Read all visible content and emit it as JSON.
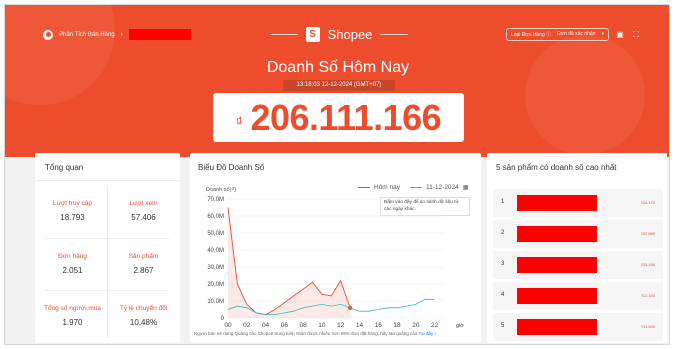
{
  "header": {
    "shop_label": "Phân Tích Bán Hàng",
    "brand": "Shopee",
    "order_type_label": "Loại Đơn Hàng ⓘ",
    "order_type_value": "Đơn đã xác nhận",
    "title": "Doanh Số Hôm Nay",
    "timestamp": "13:18:03 12-12-2024 (GMT+07)",
    "currency": "₫",
    "sales_value": "206.111.166",
    "redact_color": "#ff0000",
    "accent_color": "#ee4d2d"
  },
  "overview": {
    "title": "Tổng quan",
    "metrics": [
      {
        "label": "Lượt truy cập",
        "value": "18.793"
      },
      {
        "label": "Lượt xem",
        "value": "57.406"
      },
      {
        "label": "Đơn hàng",
        "value": "2.051"
      },
      {
        "label": "Sản phẩm",
        "value": "2.867"
      },
      {
        "label": "Tổng số người mua",
        "value": "1.970"
      },
      {
        "label": "Tỷ lệ chuyển đổi",
        "value": "10,48%"
      }
    ]
  },
  "chart_panel": {
    "title": "Biểu Đồ Doanh Số",
    "legend_today": "Hôm nay",
    "legend_compare": "11-12-2024",
    "tooltip": "Bấm vào đây để so sánh dữ liệu từ các ngày khác.",
    "note_prefix": "Người bán sử dụng Quảng cáo Shopee trung bình nhận được nhiều hơn 65% đơn đặt hàng, hãy tạo quảng cáo",
    "note_link": "Tại đây !"
  },
  "chart_data": {
    "type": "line",
    "ylabel": "Doanh số(₫)",
    "xlabel": "giờ",
    "y_ticks": [
      "0",
      "10,0M",
      "20,0M",
      "30,0M",
      "40,0M",
      "50,0M",
      "60,0M",
      "70,0M"
    ],
    "x_ticks": [
      "00",
      "02",
      "04",
      "06",
      "08",
      "10",
      "12",
      "14",
      "16",
      "18",
      "20",
      "22"
    ],
    "ylim": [
      0,
      70
    ],
    "xlim": [
      0,
      23
    ],
    "series": [
      {
        "name": "Hôm nay",
        "color": "#ee4d2d",
        "x": [
          0,
          1,
          2,
          3,
          4,
          5,
          6,
          7,
          8,
          9,
          10,
          11,
          12,
          13
        ],
        "y": [
          65,
          20,
          8,
          3,
          2,
          5,
          9,
          13,
          17,
          21,
          14,
          13,
          22,
          6
        ]
      },
      {
        "name": "11-12-2024",
        "color": "#2bc0b5",
        "x": [
          0,
          1,
          2,
          3,
          4,
          5,
          6,
          7,
          8,
          9,
          10,
          11,
          12,
          13,
          14,
          15,
          16,
          17,
          18,
          19,
          20,
          21,
          22
        ],
        "y": [
          5,
          7,
          6,
          3,
          2,
          2,
          3,
          4,
          6,
          7,
          8,
          7,
          8,
          6,
          4,
          4,
          5,
          6,
          6,
          7,
          8,
          11,
          11
        ]
      }
    ]
  },
  "top_products": {
    "title": "5 sản phẩm có doanh số cao nhất",
    "items": [
      {
        "rank": "1",
        "sales": "₫44.170"
      },
      {
        "rank": "2",
        "sales": "₫37.869"
      },
      {
        "rank": "3",
        "sales": "₫33.168"
      },
      {
        "rank": "4",
        "sales": "₫12.150"
      },
      {
        "rank": "5",
        "sales": "₫11.500"
      }
    ]
  }
}
